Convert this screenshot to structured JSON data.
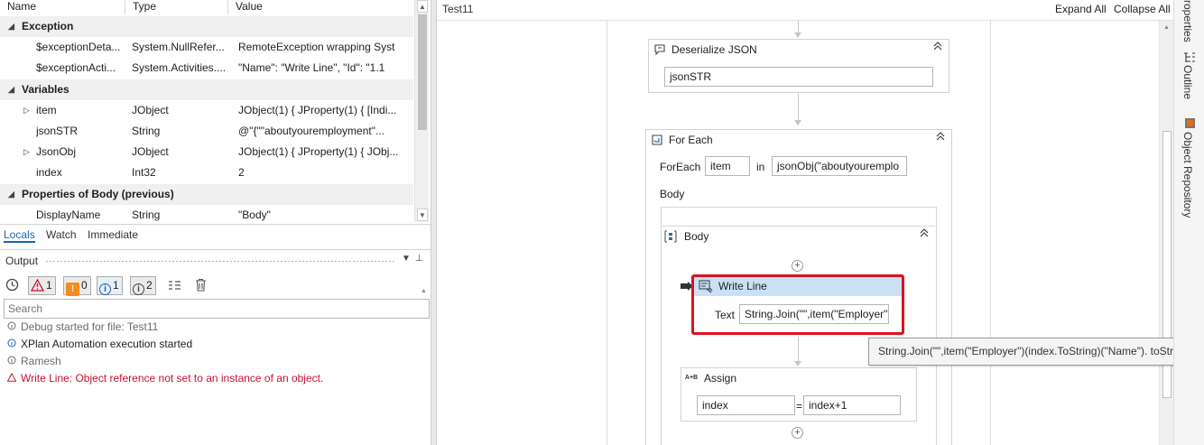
{
  "locals": {
    "columns": {
      "name": "Name",
      "type": "Type",
      "value": "Value"
    },
    "rows": [
      {
        "kind": "category",
        "label": "Exception",
        "expanded": true
      },
      {
        "kind": "item",
        "name": "$exceptionDeta...",
        "type": "System.NullRefer...",
        "value": "RemoteException wrapping Syst"
      },
      {
        "kind": "item",
        "name": "$exceptionActi...",
        "type": "System.Activities....",
        "value": "  \"Name\": \"Write Line\",  \"Id\": \"1.1"
      },
      {
        "kind": "category",
        "label": "Variables",
        "expanded": true
      },
      {
        "kind": "item",
        "name": "item",
        "type": "JObject",
        "value": "JObject(1) { JProperty(1) { [Indi...",
        "expandable": true
      },
      {
        "kind": "item",
        "name": "jsonSTR",
        "type": "String",
        "value": "@\"{\"\"aboutyouremployment\"..."
      },
      {
        "kind": "item",
        "name": "JsonObj",
        "type": "JObject",
        "value": "JObject(1) { JProperty(1) { JObj...",
        "expandable": true
      },
      {
        "kind": "item",
        "name": "index",
        "type": "Int32",
        "value": "2"
      },
      {
        "kind": "category",
        "label": "Properties of Body (previous)",
        "expanded": true
      },
      {
        "kind": "item",
        "name": "DisplayName",
        "type": "String",
        "value": "\"Body\""
      }
    ],
    "tabs": [
      "Locals",
      "Watch",
      "Immediate"
    ],
    "active_tab": "Locals"
  },
  "output": {
    "title": "Output",
    "filters": {
      "errors": "1",
      "warnings": "0",
      "info": "1",
      "trace": "2"
    },
    "search_placeholder": "Search",
    "lines": [
      {
        "level": "trace",
        "text": "Debug started for file: Test11"
      },
      {
        "level": "info",
        "text": "XPlan Automation execution started"
      },
      {
        "level": "trace",
        "text": "Ramesh"
      },
      {
        "level": "error",
        "text": "Write Line: Object reference not set to an instance of an object."
      }
    ],
    "colors": {
      "error": "#c8102e",
      "info": "#1a63b3",
      "trace": "#6b6b6b"
    }
  },
  "designer": {
    "title": "Test11",
    "expand_all": "Expand All",
    "collapse_all": "Collapse All",
    "deserialize": {
      "title": "Deserialize JSON",
      "input": "jsonSTR"
    },
    "foreach": {
      "title": "For Each",
      "foreach_label": "ForEach",
      "item_var": "item",
      "in_label": "in",
      "collection": "jsonObj(\"aboutyouremplo",
      "body_label": "Body"
    },
    "body": {
      "title": "Body"
    },
    "writeline": {
      "title": "Write Line",
      "text_label": "Text",
      "text_value": "String.Join(\"\",item(\"Employer\")",
      "error_color": "#e0101d",
      "header_color": "#c9e0f5"
    },
    "assign": {
      "title": "Assign",
      "to": "index",
      "eq": "=",
      "value": "index+1",
      "icon_text": "A+B"
    },
    "tooltip": "String.Join(\"\",item(\"Employer\")(index.ToString)(\"Name\"). toString)"
  },
  "right_dock": {
    "tabs": [
      "roperties",
      "Outline",
      "Object Repository"
    ]
  }
}
